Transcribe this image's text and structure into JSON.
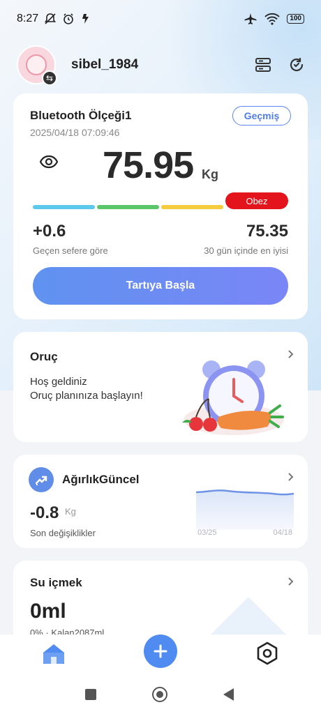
{
  "status_bar": {
    "time": "8:27",
    "battery": "100"
  },
  "header": {
    "username": "sibel_1984"
  },
  "scale_card": {
    "title": "Bluetooth Ölçeği1",
    "datetime": "2025/04/18 07:09:46",
    "history_label": "Geçmiş",
    "weight": "75.95",
    "unit": "Kg",
    "bmi_status": "Obez",
    "change_value": "+0.6",
    "change_label": "Geçen sefere göre",
    "best_value": "75.35",
    "best_label": "30 gün içinde en iyisi",
    "start_button": "Tartıya Başla",
    "bmi_colors": [
      "#5bc8ec",
      "#5cc76a",
      "#f6cc3f",
      "#e3141c"
    ]
  },
  "fasting_card": {
    "title": "Oruç",
    "line1": "Hoş geldiniz",
    "line2": "Oruç planınıza başlayın!"
  },
  "weight_card": {
    "title": "AğırlıkGüncel",
    "value": "-0.8",
    "unit": "Kg",
    "label": "Son değişiklikler",
    "date_start": "03/25",
    "date_end": "04/18"
  },
  "water_card": {
    "title": "Su içmek",
    "value": "0ml",
    "subtitle": "0% · Kalan2087ml"
  },
  "icons": {
    "status_left": [
      "muted-notification-icon",
      "alarm-icon",
      "health-icon"
    ],
    "status_right": [
      "airplane-icon",
      "wifi-icon",
      "battery-icon"
    ],
    "header": [
      "device-manage-icon",
      "sync-icon"
    ],
    "nav": [
      "home-icon",
      "add-icon",
      "settings-icon"
    ]
  },
  "accent_color": "#4f8bf0"
}
